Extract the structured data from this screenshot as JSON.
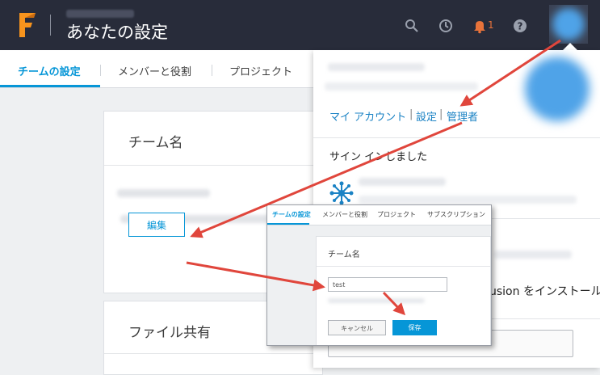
{
  "header": {
    "title": "あなたの設定",
    "notification_count": "1",
    "icons": [
      "search-icon",
      "history-icon",
      "bell-icon",
      "help-icon"
    ]
  },
  "tabs": [
    {
      "label": "チームの設定",
      "active": true
    },
    {
      "label": "メンバーと役割",
      "active": false
    },
    {
      "label": "プロジェクト",
      "active": false
    }
  ],
  "team_card": {
    "title": "チーム名",
    "edit_label": "編集"
  },
  "file_card": {
    "title": "ファイル共有"
  },
  "dropdown": {
    "links": {
      "my_account": "マイ アカウント",
      "separator": "|",
      "settings": "設定",
      "admin": "管理者"
    },
    "signed_in": "サイン インしました",
    "install_text": "usion をインストール"
  },
  "inset": {
    "tabs": [
      "チームの設定",
      "メンバーと役割",
      "プロジェクト",
      "サブスクリプション"
    ],
    "card_title": "チーム名",
    "input_value": "test",
    "cancel_label": "キャンセル",
    "save_label": "保存"
  },
  "colors": {
    "header_bg": "#282c3a",
    "accent": "#0696d7",
    "link": "#1a82c4",
    "annotation_arrow": "#e0463c",
    "notification": "#e8733a"
  }
}
